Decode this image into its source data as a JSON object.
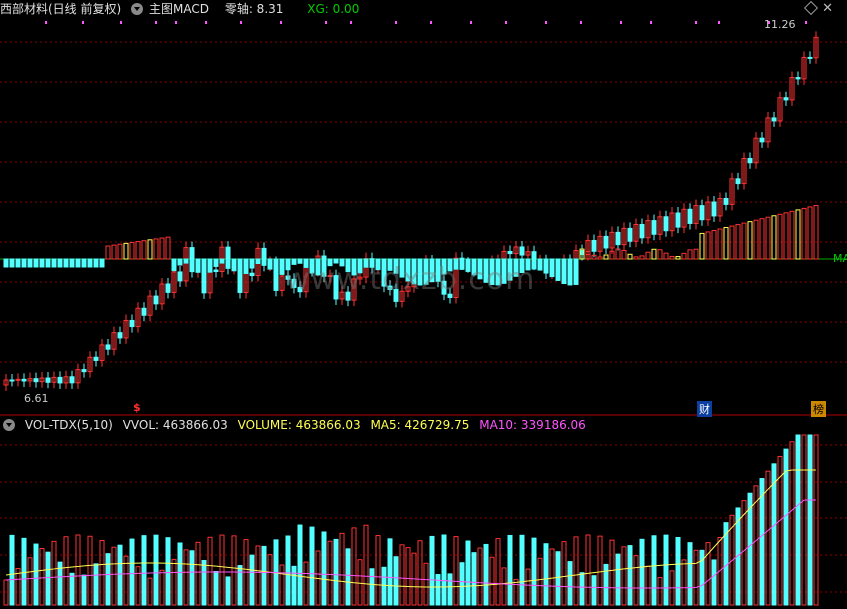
{
  "main": {
    "title": "西部材料(日线 前复权)",
    "indicator": "主图MACD",
    "zero_axis_label": "零轴: 8.31",
    "xg_label": "XG: 0.00",
    "high_label": "11.26",
    "low_label": "6.61",
    "ma_label": "MA",
    "marker_dollar": "$",
    "marker_cai": "财",
    "marker_bang": "榜",
    "watermark": "www.tdxzb.com"
  },
  "volume": {
    "indicator": "VOL-TDX(5,10)",
    "vvol": "VVOL: 463866.03",
    "volume": "VOLUME: 463866.03",
    "ma5": "MA5: 426729.75",
    "ma10": "MA10: 339186.06"
  },
  "colors": {
    "up": "#ff3232",
    "down": "#54ffff",
    "gold": "#ffff54",
    "magenta": "#ff54ff",
    "green": "#00cc00",
    "grid": "#8b0000"
  }
}
